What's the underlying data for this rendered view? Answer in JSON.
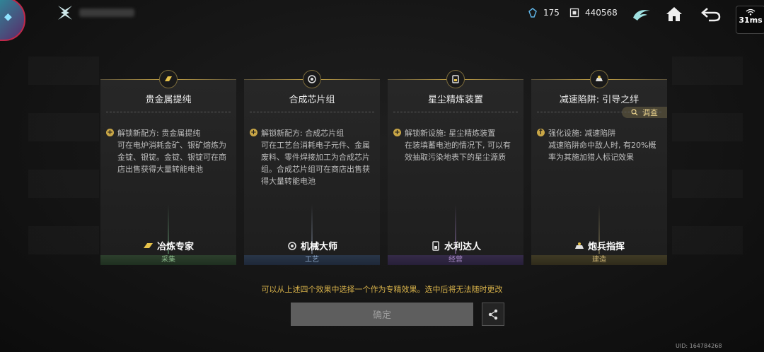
{
  "topbar": {
    "crystal_count": "175",
    "chip_count": "440568",
    "ping": "31ms",
    "icons": [
      "logo-icon",
      "crystal-icon",
      "chip-icon",
      "emblem-icon",
      "home-icon",
      "back-icon",
      "wifi-icon"
    ]
  },
  "cards": [
    {
      "title": "贵金属提纯",
      "body": "解锁新配方: 贵金属提纯\n可在电炉消耗金矿、银矿熔炼为金锭、银锭。金锭、银锭可在商店出售获得大量转能电池",
      "skill": "冶炼专家",
      "category": "采集",
      "accent": "#8ab98a"
    },
    {
      "title": "合成芯片组",
      "body": "解锁新配方: 合成芯片组\n可在工艺台消耗电子元件、金属废料、零件焊接加工为合成芯片组。合成芯片组可在商店出售获得大量转能电池",
      "skill": "机械大师",
      "category": "工艺",
      "accent": "#8aa6c8"
    },
    {
      "title": "星尘精炼装置",
      "body": "解锁新设施: 星尘精炼装置\n在装填蓄电池的情况下, 可以有效抽取污染地表下的星尘源质",
      "skill": "水利达人",
      "category": "经营",
      "accent": "#a88ac8"
    },
    {
      "title": "减速陷阱: 引导之绊",
      "body": "强化设施: 减速陷阱\n减速陷阱命中敌人时, 有20%概率为其施加猎人标记效果",
      "skill": "炮兵指挥",
      "category": "建造",
      "accent": "#c8b070",
      "inspect_label": "调查"
    }
  ],
  "hint": "可以从上述四个效果中选择一个作为专精效果。选中后将无法随时更改",
  "confirm_label": "确定",
  "uid": "UID: 164784268"
}
